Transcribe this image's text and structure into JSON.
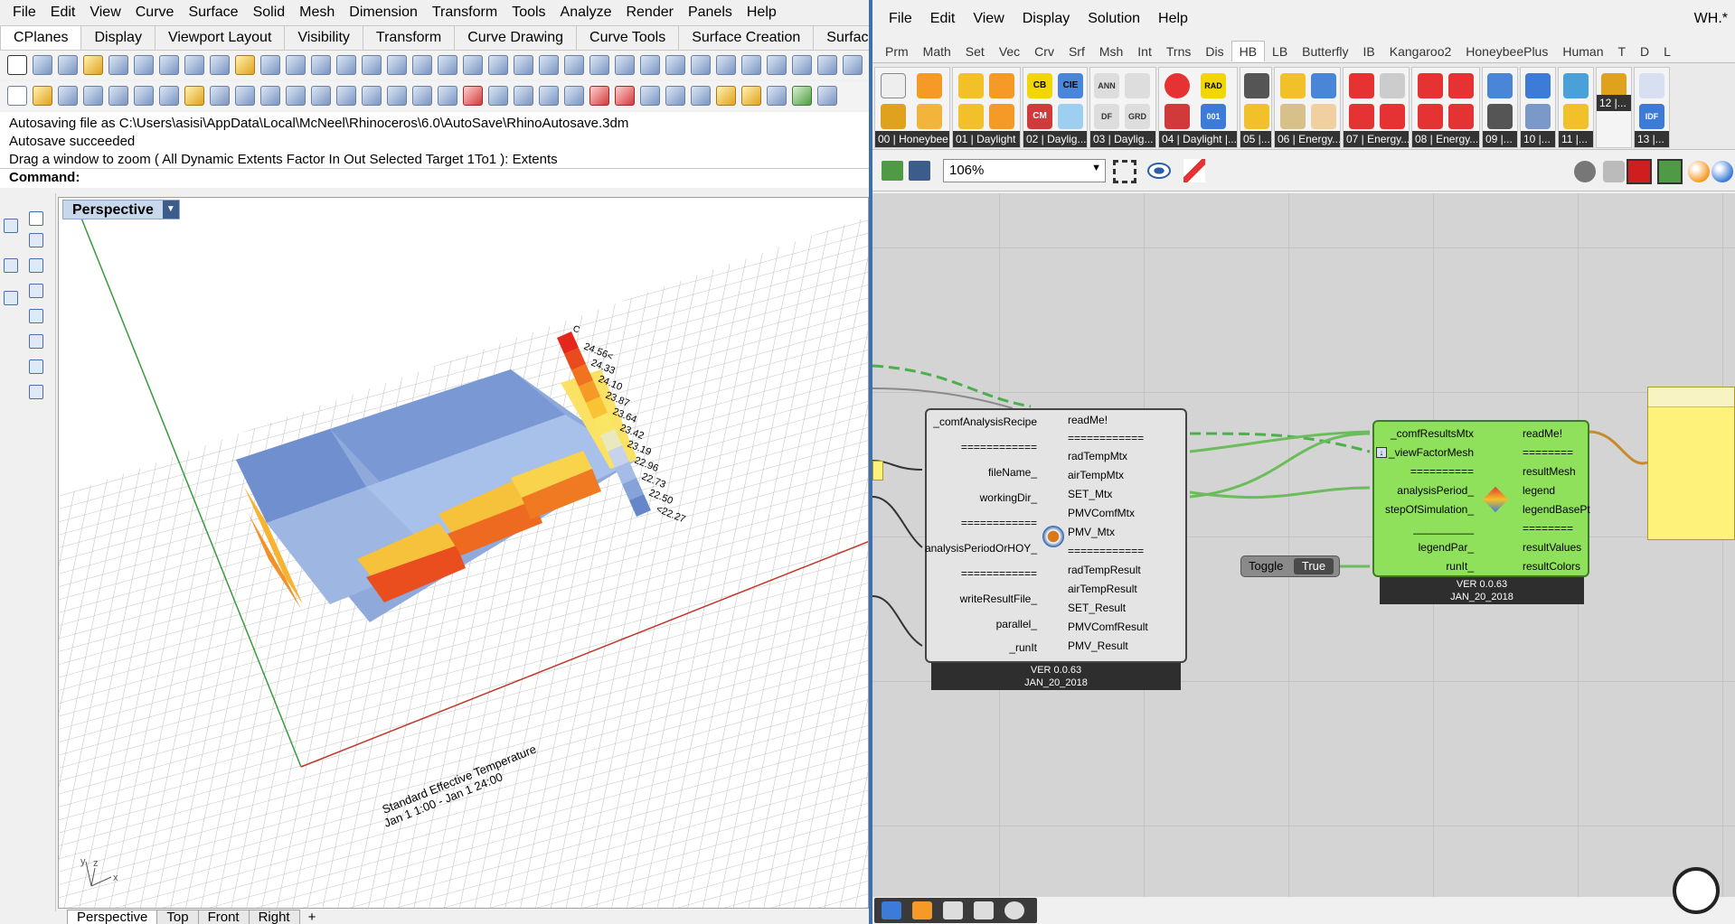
{
  "rhino": {
    "menu": [
      "File",
      "Edit",
      "View",
      "Curve",
      "Surface",
      "Solid",
      "Mesh",
      "Dimension",
      "Transform",
      "Tools",
      "Analyze",
      "Render",
      "Panels",
      "Help"
    ],
    "toolbar_tabs": [
      "CPlanes",
      "Display",
      "Viewport Layout",
      "Visibility",
      "Transform",
      "Curve Drawing",
      "Curve Tools",
      "Surface Creation",
      "Surface Tool"
    ],
    "command_history": [
      "Autosaving file as C:\\Users\\asisi\\AppData\\Local\\McNeel\\Rhinoceros\\6.0\\AutoSave\\RhinoAutosave.3dm",
      "Autosave succeeded",
      "Drag a window to zoom ( All  Dynamic  Extents  Factor  In  Out  Selected  Target  1To1 ): Extents"
    ],
    "command_prompt": "Command:",
    "viewport_title": "Perspective",
    "viewport_tabs": [
      "Perspective",
      "Top",
      "Front",
      "Right"
    ],
    "legend": {
      "unit": "C",
      "values": [
        "24.56<",
        "24.33",
        "24.10",
        "23.87",
        "23.64",
        "23.42",
        "23.19",
        "22.96",
        "22.73",
        "22.50",
        "<22.27"
      ],
      "colors": [
        "#e5261a",
        "#ea4a1d",
        "#f07320",
        "#f59a26",
        "#f9c433",
        "#fbe664",
        "#e9e9c0",
        "#c6d3ea",
        "#a4bce6",
        "#86a3d9",
        "#6586c8"
      ]
    },
    "analysis_title": "Standard Effective Temperature",
    "analysis_period": "Jan 1 1:00 - Jan 1 24:00",
    "axis_labels": {
      "x": "x",
      "y": "y",
      "z": "z"
    }
  },
  "grasshopper": {
    "menu": [
      "File",
      "Edit",
      "View",
      "Display",
      "Solution",
      "Help"
    ],
    "window_title": "WH.*",
    "tabs": [
      "Prm",
      "Math",
      "Set",
      "Vec",
      "Crv",
      "Srf",
      "Msh",
      "Int",
      "Trns",
      "Dis",
      "HB",
      "LB",
      "Butterfly",
      "IB",
      "Kangaroo2",
      "HoneybeePlus",
      "Human",
      "T",
      "D",
      "L"
    ],
    "active_tab": "HB",
    "ribbon_groups": [
      "00 | Honeybee",
      "01 | Daylight |...",
      "02 | Daylig...",
      "03 | Daylig...",
      "04 | Daylight |...",
      "05 |...",
      "06 | Energy...",
      "07 | Energy...",
      "08 | Energy...",
      "09 |...",
      "10 |...",
      "11 |...",
      "12 |...",
      "13 |..."
    ],
    "ribbon_glyphs": [
      "ANN",
      "DF",
      "GRD",
      "RAD",
      "001",
      "CB",
      "CIE",
      "CM",
      "IDF"
    ],
    "zoom": "106%",
    "component_a": {
      "inputs": [
        "_comfAnalysisRecipe",
        "============",
        "fileName_",
        "workingDir_",
        "============",
        "analysisPeriodOrHOY_",
        "============",
        "writeResultFile_",
        "parallel_",
        "_runIt"
      ],
      "outputs": [
        "readMe!",
        "============",
        "radTempMtx",
        "airTempMtx",
        "SET_Mtx",
        "PMVComfMtx",
        "PMV_Mtx",
        "============",
        "radTempResult",
        "airTempResult",
        "SET_Result",
        "PMVComfResult",
        "PMV_Result"
      ],
      "version": "VER 0.0.63",
      "date": "JAN_20_2018"
    },
    "component_b": {
      "inputs": [
        "_comfResultsMtx",
        "_viewFactorMesh",
        "==========",
        "analysisPeriod_",
        "stepOfSimulation_",
        "__________",
        "legendPar_",
        "runIt_"
      ],
      "outputs": [
        "readMe!",
        "========",
        "resultMesh",
        "legend",
        "legendBasePt",
        "========",
        "resultValues",
        "resultColors"
      ],
      "version": "VER 0.0.63",
      "date": "JAN_20_2018"
    },
    "toggle": {
      "label": "Toggle",
      "value": "True"
    }
  }
}
